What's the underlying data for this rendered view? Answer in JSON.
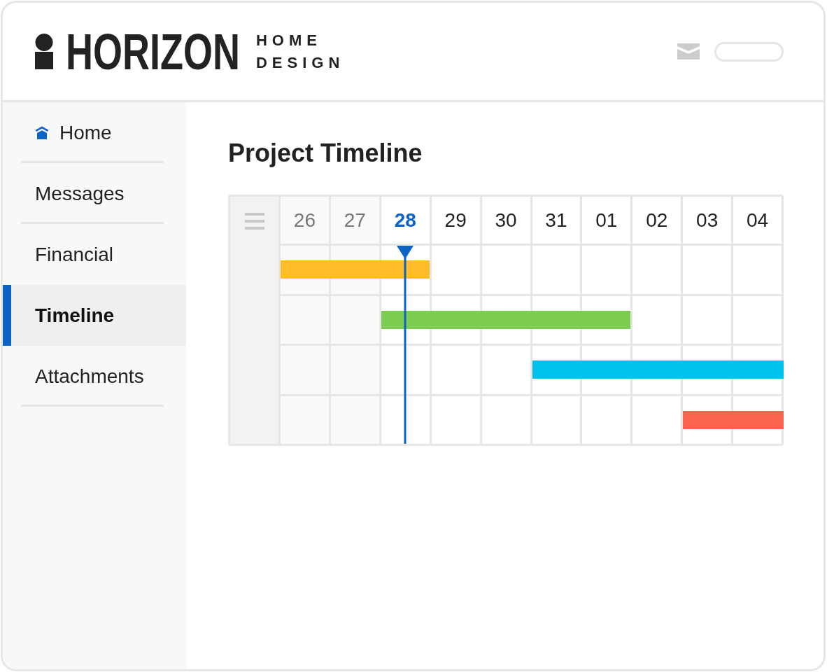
{
  "header": {
    "wordmark": "HORIZON",
    "tagline": "HOME DESIGN"
  },
  "sidebar": {
    "items": [
      {
        "label": "Home",
        "kind": "home",
        "selected": false
      },
      {
        "label": "Messages",
        "kind": "page",
        "selected": false
      },
      {
        "label": "Financial",
        "kind": "page",
        "selected": false
      },
      {
        "label": "Timeline",
        "kind": "page",
        "selected": true
      },
      {
        "label": "Attachments",
        "kind": "page",
        "selected": false
      }
    ]
  },
  "timeline": {
    "title": "Project Timeline",
    "days": [
      {
        "label": "26",
        "kind": "past"
      },
      {
        "label": "27",
        "kind": "past"
      },
      {
        "label": "28",
        "kind": "today"
      },
      {
        "label": "29",
        "kind": "upcoming"
      },
      {
        "label": "30",
        "kind": "upcoming"
      },
      {
        "label": "31",
        "kind": "upcoming"
      },
      {
        "label": "01",
        "kind": "upcoming"
      },
      {
        "label": "02",
        "kind": "upcoming"
      },
      {
        "label": "03",
        "kind": "upcoming"
      },
      {
        "label": "04",
        "kind": "upcoming"
      }
    ],
    "rows": [
      {
        "color": "#ffbb28",
        "scheduled": [
          true,
          true,
          true,
          false,
          false,
          false,
          false,
          false,
          false,
          false
        ]
      },
      {
        "color": "#7ccd50",
        "scheduled": [
          false,
          false,
          true,
          true,
          true,
          true,
          true,
          false,
          false,
          false
        ]
      },
      {
        "color": "#00c2ec",
        "scheduled": [
          false,
          false,
          false,
          false,
          false,
          true,
          true,
          true,
          true,
          true
        ]
      },
      {
        "color": "#fa644c",
        "scheduled": [
          false,
          false,
          false,
          false,
          false,
          false,
          false,
          false,
          true,
          true
        ]
      }
    ]
  }
}
